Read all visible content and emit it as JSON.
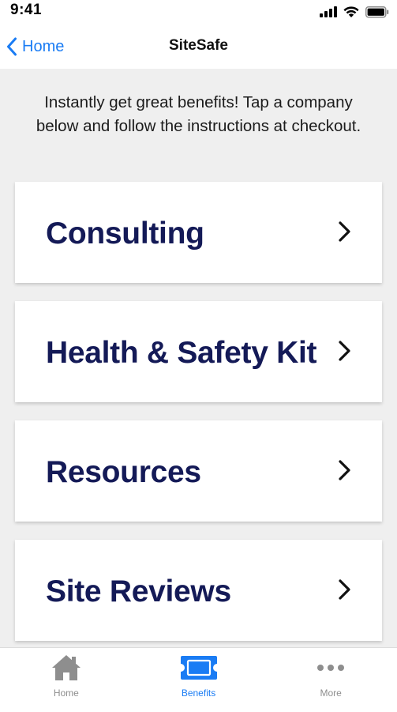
{
  "status_bar": {
    "time": "9:41"
  },
  "nav": {
    "back_label": "Home",
    "title": "SiteSafe"
  },
  "intro": {
    "text": "Instantly get great benefits! Tap a company below and follow the instructions at checkout."
  },
  "cards": [
    {
      "label": "Consulting"
    },
    {
      "label": "Health & Safety Kit"
    },
    {
      "label": "Resources"
    },
    {
      "label": "Site Reviews"
    }
  ],
  "tabs": [
    {
      "label": "Home",
      "icon": "house-icon"
    },
    {
      "label": "Benefits",
      "icon": "ticket-icon",
      "active": true
    },
    {
      "label": "More",
      "icon": "more-dots-icon"
    }
  ],
  "colors": {
    "accent": "#1a7cf4",
    "card_text": "#141a57",
    "background": "#efefef",
    "inactive_tab": "#8e8e8e"
  }
}
